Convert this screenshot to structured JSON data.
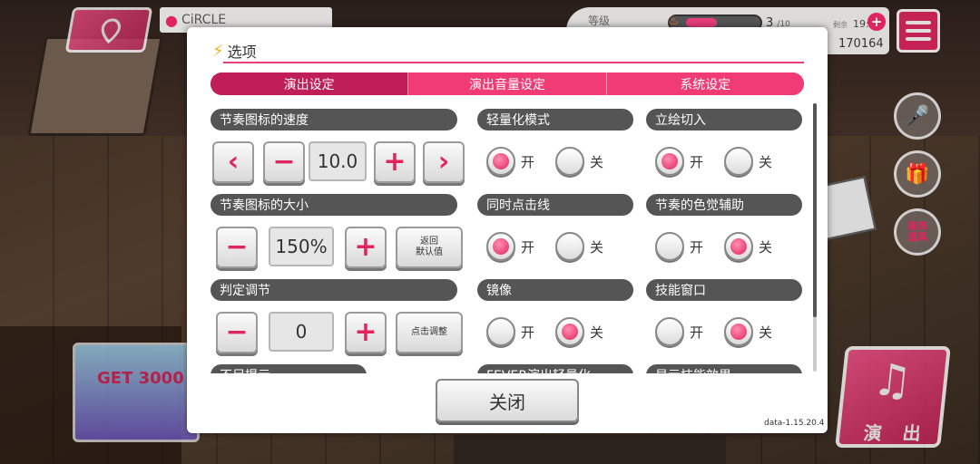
{
  "background": {
    "location": "CiRCLE",
    "hud": {
      "level_label": "等级",
      "energy_count": "3",
      "energy_max": "/10",
      "remaining_label": "剩余",
      "time": "19:39",
      "coins": "170164"
    },
    "side_buttons": {
      "costume_label_1": "装饰",
      "costume_label_2": "道具"
    },
    "perform_label": "演 出",
    "promo_text": "GET 3000"
  },
  "dialog": {
    "title": "选项",
    "tabs": [
      "演出设定",
      "演出音量设定",
      "系统设定"
    ],
    "active_tab": 0,
    "note_speed": {
      "label": "节奏图标的速度",
      "value": "10.0"
    },
    "note_size": {
      "label": "节奏图标的大小",
      "value": "150%",
      "reset_line1": "返回",
      "reset_line2": "默认值"
    },
    "judge_adjust": {
      "label": "判定调节",
      "value": "0",
      "tap_adjust": "点击调整"
    },
    "lightweight": {
      "label": "轻量化模式",
      "on": "开",
      "off": "关",
      "selected": "on"
    },
    "portrait_cut": {
      "label": "立绘切入",
      "on": "开",
      "off": "关",
      "selected": "on"
    },
    "simul_line": {
      "label": "同时点击线",
      "on": "开",
      "off": "关",
      "selected": "on"
    },
    "color_assist": {
      "label": "节奏的色觉辅助",
      "on": "开",
      "off": "关",
      "selected": "off"
    },
    "mirror": {
      "label": "镜像",
      "on": "开",
      "off": "关",
      "selected": "off"
    },
    "skill_window": {
      "label": "技能窗口",
      "on": "开",
      "off": "关",
      "selected": "off"
    },
    "partial_rows": [
      "不足提示",
      "FEVER演出轻量化",
      "显示技能效果"
    ],
    "close_label": "关闭",
    "version": "data-1.15.20.4"
  },
  "colors": {
    "accent": "#e0245e",
    "header": "#555555"
  }
}
